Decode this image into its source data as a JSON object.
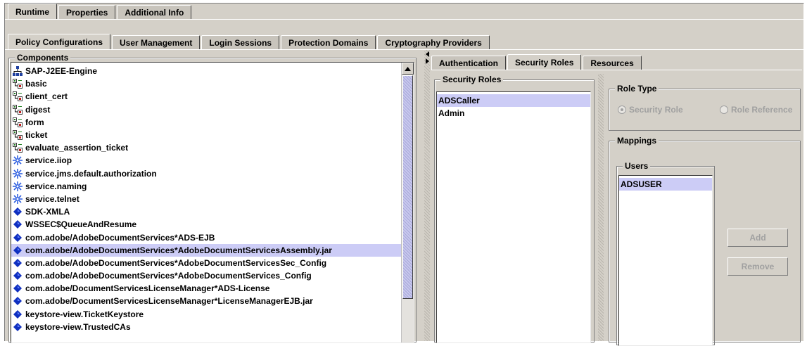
{
  "top_tabs": [
    {
      "label": "Runtime",
      "active": true
    },
    {
      "label": "Properties",
      "active": false
    },
    {
      "label": "Additional Info",
      "active": false
    }
  ],
  "sub_tabs": [
    {
      "label": "Policy Configurations",
      "active": true
    },
    {
      "label": "User Management",
      "active": false
    },
    {
      "label": "Login Sessions",
      "active": false
    },
    {
      "label": "Protection Domains",
      "active": false
    },
    {
      "label": "Cryptography Providers",
      "active": false
    }
  ],
  "components": {
    "title": "Components",
    "items": [
      {
        "label": "SAP-J2EE-Engine",
        "icon": "server-tree-icon"
      },
      {
        "label": "basic",
        "icon": "policy-node-icon"
      },
      {
        "label": "client_cert",
        "icon": "policy-node-icon"
      },
      {
        "label": "digest",
        "icon": "policy-node-icon"
      },
      {
        "label": "form",
        "icon": "policy-node-icon"
      },
      {
        "label": "ticket",
        "icon": "policy-node-icon"
      },
      {
        "label": "evaluate_assertion_ticket",
        "icon": "policy-node-icon"
      },
      {
        "label": "service.iiop",
        "icon": "service-snowflake-icon"
      },
      {
        "label": "service.jms.default.authorization",
        "icon": "service-snowflake-icon"
      },
      {
        "label": "service.naming",
        "icon": "service-snowflake-icon"
      },
      {
        "label": "service.telnet",
        "icon": "service-snowflake-icon"
      },
      {
        "label": "SDK-XMLA",
        "icon": "component-diamond-icon"
      },
      {
        "label": "WSSEC$QueueAndResume",
        "icon": "component-diamond-icon"
      },
      {
        "label": "com.adobe/AdobeDocumentServices*ADS-EJB",
        "icon": "component-diamond-icon"
      },
      {
        "label": "com.adobe/AdobeDocumentServices*AdobeDocumentServicesAssembly.jar",
        "icon": "component-diamond-icon",
        "selected": true
      },
      {
        "label": "com.adobe/AdobeDocumentServices*AdobeDocumentServicesSec_Config",
        "icon": "component-diamond-icon"
      },
      {
        "label": "com.adobe/AdobeDocumentServices*AdobeDocumentServices_Config",
        "icon": "component-diamond-icon"
      },
      {
        "label": "com.adobe/DocumentServicesLicenseManager*ADS-License",
        "icon": "component-diamond-icon"
      },
      {
        "label": "com.adobe/DocumentServicesLicenseManager*LicenseManagerEJB.jar",
        "icon": "component-diamond-icon"
      },
      {
        "label": "keystore-view.TicketKeystore",
        "icon": "component-diamond-icon"
      },
      {
        "label": "keystore-view.TrustedCAs",
        "icon": "component-diamond-icon"
      }
    ]
  },
  "detail_tabs": [
    {
      "label": "Authentication",
      "active": false
    },
    {
      "label": "Security Roles",
      "active": true
    },
    {
      "label": "Resources",
      "active": false
    }
  ],
  "security_roles": {
    "title": "Security Roles",
    "items": [
      {
        "label": "ADSCaller",
        "selected": true
      },
      {
        "label": "Admin",
        "selected": false
      }
    ]
  },
  "role_type": {
    "title": "Role Type",
    "options": [
      {
        "label": "Security Role",
        "checked": true
      },
      {
        "label": "Role Reference",
        "checked": false
      }
    ]
  },
  "mappings": {
    "title": "Mappings",
    "users_title": "Users",
    "users": [
      {
        "label": "ADSUSER",
        "selected": true
      }
    ],
    "add_label": "Add",
    "remove_label": "Remove"
  },
  "colors": {
    "panel": "#d4d0c8",
    "selection": "#ccccf6",
    "disabled_text": "#a0a0a0",
    "service_icon": "#3060e0",
    "diamond_icon": "#1030c0",
    "policy_icon_green": "#208020",
    "policy_icon_red": "#c02020"
  }
}
